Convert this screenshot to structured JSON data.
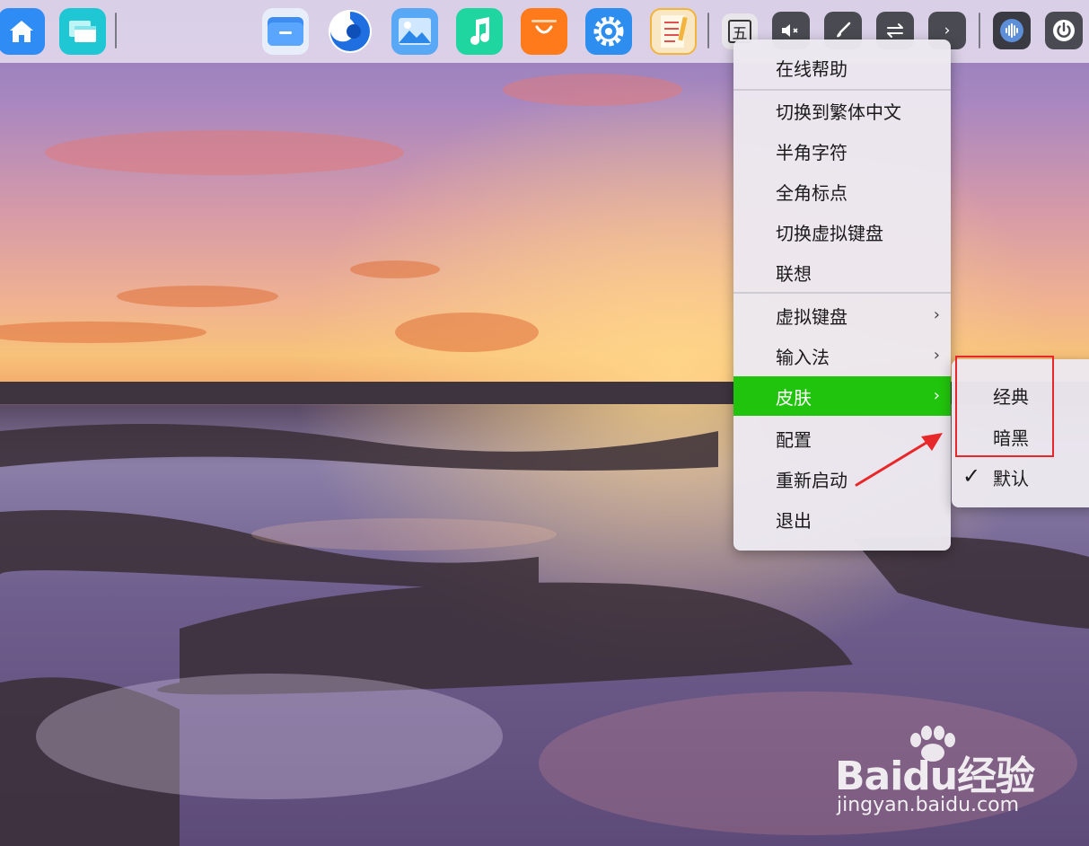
{
  "taskbar": {
    "apps": [
      {
        "icon": "home-icon",
        "color": "#2f8cf5"
      },
      {
        "icon": "multitask-window-icon",
        "color": "#1fc7d4"
      },
      {
        "icon": "file-manager-icon",
        "color": "#3c8cf2"
      },
      {
        "icon": "browser-icon",
        "color": "#1f6fe0"
      },
      {
        "icon": "photo-viewer-icon",
        "color": "#58a8f5"
      },
      {
        "icon": "music-icon",
        "color": "#1fd6a0"
      },
      {
        "icon": "app-store-icon",
        "color": "#ff7a1a"
      },
      {
        "icon": "settings-icon",
        "color": "#2d8ef0"
      },
      {
        "icon": "notepad-icon",
        "color": "#f2b43c"
      }
    ],
    "tray": {
      "input_method_label": "五",
      "volume_icon": "volume-muted-icon",
      "brush_icon": "brush-icon",
      "switch_icon": "switch-arrows-icon",
      "expand_icon": "chevron-right-icon",
      "network_icon": "network-icon",
      "power_icon": "power-icon"
    }
  },
  "menu": {
    "items": [
      {
        "label": "在线帮助"
      },
      {
        "label": "切换到繁体中文"
      },
      {
        "label": "半角字符"
      },
      {
        "label": "全角标点"
      },
      {
        "label": "切换虚拟键盘"
      },
      {
        "label": "联想"
      },
      {
        "label": "虚拟键盘",
        "arrow": "›"
      },
      {
        "label": "输入法",
        "arrow": "›"
      },
      {
        "label": "皮肤",
        "arrow": "›"
      },
      {
        "label": "配置"
      },
      {
        "label": "重新启动"
      },
      {
        "label": "退出"
      }
    ],
    "active_color": "#21c40c"
  },
  "submenu": {
    "items": [
      {
        "label": "经典"
      },
      {
        "label": "暗黑"
      },
      {
        "label": "默认",
        "check": "✓"
      }
    ]
  },
  "annotation": {
    "box_color": "#e8272a"
  },
  "watermark": {
    "logo_text": "Baidu经验",
    "url": "jingyan.baidu.com"
  }
}
